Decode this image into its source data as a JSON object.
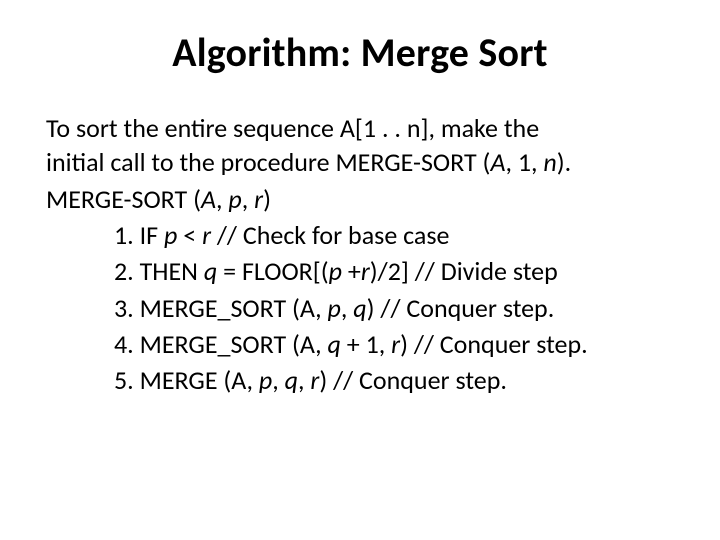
{
  "title": "Algorithm: Merge Sort",
  "intro_a": "To sort the entire sequence A[1 . . n], make the",
  "intro_b_pre": "initial call to the procedure MERGE-SORT (",
  "intro_b_A": "A",
  "intro_b_mid": ", 1, ",
  "intro_b_n": "n",
  "intro_b_post": ").",
  "sig_pre": "MERGE-SORT (",
  "sig_A": "A",
  "sig_c1": ", ",
  "sig_p": "p",
  "sig_c2": ", ",
  "sig_r": "r",
  "sig_post": ")",
  "s1_pre": "1. IF ",
  "s1_p": "p",
  "s1_mid": " < ",
  "s1_r": "r",
  "s1_post": " // Check for base case",
  "s2_pre": "2. THEN ",
  "s2_q": "q",
  "s2_mid1": " = FLOOR[(",
  "s2_p": "p",
  "s2_mid2": " +",
  "s2_r": "r",
  "s2_post": ")/2] // Divide step",
  "s3_pre": "3. MERGE_SORT (A, ",
  "s3_p": "p",
  "s3_c": ", ",
  "s3_q": "q",
  "s3_post": ") // Conquer step.",
  "s4_pre": "4. MERGE_SORT (A, ",
  "s4_q": "q",
  "s4_mid": " + 1, ",
  "s4_r": "r",
  "s4_post": ") // Conquer step.",
  "s5_pre": "5. MERGE (A, ",
  "s5_p": "p",
  "s5_c1": ", ",
  "s5_q": "q",
  "s5_c2": ", ",
  "s5_r": "r",
  "s5_post": ") // Conquer step."
}
